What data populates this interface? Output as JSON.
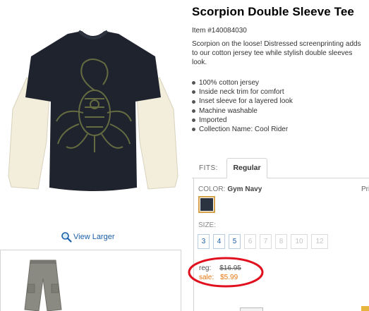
{
  "product": {
    "title": "Scorpion Double Sleeve Tee",
    "item_number": "Item #140084030",
    "description_lines": [
      "Scorpion on the loose! Distressed screenprinting adds",
      "to our cotton jersey tee while stylish double sleeves",
      "look."
    ],
    "features": [
      "100% cotton jersey",
      "Inside neck trim for comfort",
      "Inset sleeve for a layered look",
      "Machine washable",
      "Imported",
      "Collection Name: Cool Rider"
    ]
  },
  "image": {
    "view_larger": "View Larger",
    "icon": "magnifier-icon",
    "shirt_body_color": "#1f232d",
    "sleeve_color": "#f3eedc",
    "print_color": "#6c7344"
  },
  "fits": {
    "label": "FITS:",
    "tabs": [
      "Regular"
    ]
  },
  "options": {
    "color_label": "COLOR:",
    "color_value": "Gym Navy",
    "price_hint": "Pri",
    "swatch_color": "#2b3340",
    "size_label": "SIZE:",
    "sizes": [
      {
        "label": "3",
        "available": true
      },
      {
        "label": "4",
        "available": true
      },
      {
        "label": "5",
        "available": true
      },
      {
        "label": "6",
        "available": false
      },
      {
        "label": "7",
        "available": false
      },
      {
        "label": "8",
        "available": false
      },
      {
        "label": "10",
        "available": false
      },
      {
        "label": "12",
        "available": false
      }
    ]
  },
  "price": {
    "reg_label": "reg:",
    "reg_value": "$16.95",
    "sale_label": "sale:",
    "sale_value": "$5.99",
    "sale_color": "#e8750f",
    "highlight_color": "#e0101e"
  },
  "colors": {
    "link": "#1a5fa8",
    "selected_swatch_border": "#d4a24a",
    "pants_color": "#8a8a82"
  }
}
